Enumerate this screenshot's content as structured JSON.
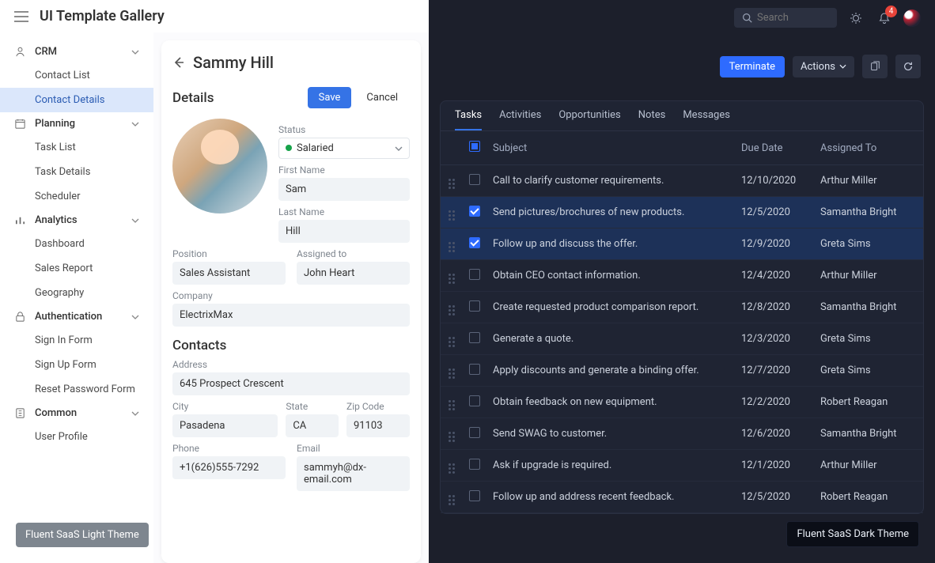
{
  "app_title": "UI Template Gallery",
  "sidebar": {
    "groups": [
      {
        "label": "CRM",
        "icon": "user-circle",
        "items": [
          {
            "label": "Contact List"
          },
          {
            "label": "Contact Details",
            "active": true
          }
        ]
      },
      {
        "label": "Planning",
        "icon": "calendar",
        "items": [
          {
            "label": "Task List"
          },
          {
            "label": "Task Details"
          },
          {
            "label": "Scheduler"
          }
        ]
      },
      {
        "label": "Analytics",
        "icon": "bars",
        "items": [
          {
            "label": "Dashboard"
          },
          {
            "label": "Sales Report"
          },
          {
            "label": "Geography"
          }
        ]
      },
      {
        "label": "Authentication",
        "icon": "lock",
        "items": [
          {
            "label": "Sign In Form"
          },
          {
            "label": "Sign Up Form"
          },
          {
            "label": "Reset Password Form"
          }
        ]
      },
      {
        "label": "Common",
        "icon": "sliders",
        "items": [
          {
            "label": "User Profile"
          }
        ]
      }
    ]
  },
  "light_theme_badge": "Fluent SaaS Light Theme",
  "contact": {
    "name": "Sammy Hill",
    "details_title": "Details",
    "save_label": "Save",
    "cancel_label": "Cancel",
    "status_label": "Status",
    "status_value": "Salaried",
    "first_name_label": "First Name",
    "first_name_value": "Sam",
    "last_name_label": "Last Name",
    "last_name_value": "Hill",
    "position_label": "Position",
    "position_value": "Sales Assistant",
    "assigned_label": "Assigned to",
    "assigned_value": "John Heart",
    "company_label": "Company",
    "company_value": "ElectrixMax",
    "contacts_title": "Contacts",
    "address_label": "Address",
    "address_value": "645 Prospect Crescent",
    "city_label": "City",
    "city_value": "Pasadena",
    "state_label": "State",
    "state_value": "CA",
    "zip_label": "Zip Code",
    "zip_value": "91103",
    "phone_label": "Phone",
    "phone_value": "+1(626)555-7292",
    "email_label": "Email",
    "email_value": "sammyh@dx-email.com"
  },
  "dark": {
    "search_placeholder": "Search",
    "notif_count": "4",
    "terminate_label": "Terminate",
    "actions_label": "Actions",
    "tabs": [
      "Tasks",
      "Activities",
      "Opportunities",
      "Notes",
      "Messages"
    ],
    "active_tab": 0,
    "columns": {
      "subject": "Subject",
      "due": "Due Date",
      "assigned": "Assigned To"
    },
    "rows": [
      {
        "subject": "Call to clarify customer requirements.",
        "due": "12/10/2020",
        "assigned": "Arthur Miller",
        "checked": false
      },
      {
        "subject": "Send pictures/brochures of new products.",
        "due": "12/5/2020",
        "assigned": "Samantha Bright",
        "checked": true
      },
      {
        "subject": "Follow up and discuss the offer.",
        "due": "12/9/2020",
        "assigned": "Greta Sims",
        "checked": true
      },
      {
        "subject": "Obtain CEO contact information.",
        "due": "12/4/2020",
        "assigned": "Arthur Miller",
        "checked": false
      },
      {
        "subject": "Create requested product comparison report.",
        "due": "12/8/2020",
        "assigned": "Samantha Bright",
        "checked": false
      },
      {
        "subject": "Generate a quote.",
        "due": "12/3/2020",
        "assigned": "Greta Sims",
        "checked": false
      },
      {
        "subject": "Apply discounts and generate a binding offer.",
        "due": "12/7/2020",
        "assigned": "Greta Sims",
        "checked": false
      },
      {
        "subject": "Obtain feedback on new equipment.",
        "due": "12/2/2020",
        "assigned": "Robert Reagan",
        "checked": false
      },
      {
        "subject": "Send SWAG to customer.",
        "due": "12/6/2020",
        "assigned": "Samantha Bright",
        "checked": false
      },
      {
        "subject": "Ask if upgrade is required.",
        "due": "12/1/2020",
        "assigned": "Arthur Miller",
        "checked": false
      },
      {
        "subject": "Follow up and address recent feedback.",
        "due": "12/5/2020",
        "assigned": "Robert Reagan",
        "checked": false
      }
    ],
    "theme_badge": "Fluent SaaS Dark Theme"
  }
}
